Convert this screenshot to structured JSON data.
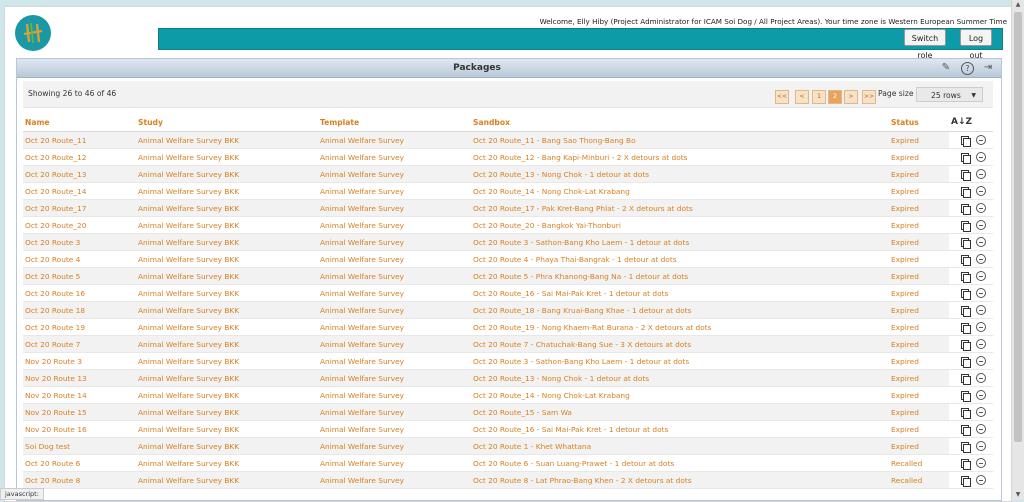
{
  "header": {
    "welcome": "Welcome, Elly Hiby (Project Administrator for ICAM Soi Dog / All Project Areas). Your time zone is Western European Summer Time",
    "switch_role": "Switch role",
    "logout": "Log out"
  },
  "panel": {
    "title": "Packages",
    "icons": [
      "pencil-icon",
      "help-icon",
      "exit-icon"
    ]
  },
  "toolbar": {
    "showing": "Showing 26 to 46 of 46",
    "pager": {
      "first": "<<",
      "prev": "<",
      "pages": [
        "1",
        "2"
      ],
      "next": ">",
      "last": ">>"
    },
    "page_size_label": "Page size",
    "page_size_value": "25 rows"
  },
  "table": {
    "columns": [
      "Name",
      "Study",
      "Template",
      "Sandbox",
      "Status"
    ],
    "rows": [
      [
        "Oct 20 Route_11",
        "Animal Welfare Survey BKK",
        "Animal Welfare Survey",
        "Oct 20 Route_11 - Bang Sao Thong-Bang Bo",
        "Expired"
      ],
      [
        "Oct 20 Route_12",
        "Animal Welfare Survey BKK",
        "Animal Welfare Survey",
        "Oct 20 Route_12 - Bang Kapi-Minburi - 2 X detours at dots",
        "Expired"
      ],
      [
        "Oct 20 Route_13",
        "Animal Welfare Survey BKK",
        "Animal Welfare Survey",
        "Oct 20 Route_13 - Nong Chok - 1 detour at dots",
        "Expired"
      ],
      [
        "Oct 20 Route_14",
        "Animal Welfare Survey BKK",
        "Animal Welfare Survey",
        "Oct 20 Route_14 - Nong Chok-Lat Krabang",
        "Expired"
      ],
      [
        "Oct 20 Route_17",
        "Animal Welfare Survey BKK",
        "Animal Welfare Survey",
        "Oct 20 Route_17 - Pak Kret-Bang Phlat - 2 X detours at dots",
        "Expired"
      ],
      [
        "Oct 20 Route_20",
        "Animal Welfare Survey BKK",
        "Animal Welfare Survey",
        "Oct 20 Route_20 - Bangkok Yai-Thonburi",
        "Expired"
      ],
      [
        "Oct 20 Route 3",
        "Animal Welfare Survey BKK",
        "Animal Welfare Survey",
        "Oct 20 Route 3 - Sathon-Bang Kho Laem - 1 detour at dots",
        "Expired"
      ],
      [
        "Oct 20 Route 4",
        "Animal Welfare Survey BKK",
        "Animal Welfare Survey",
        "Oct 20 Route 4 - Phaya Thai-Bangrak - 1 detour at dots",
        "Expired"
      ],
      [
        "Oct 20 Route 5",
        "Animal Welfare Survey BKK",
        "Animal Welfare Survey",
        "Oct 20 Route 5 - Phra Khanong-Bang Na - 1 detour at dots",
        "Expired"
      ],
      [
        "Oct 20 Route 16",
        "Animal Welfare Survey BKK",
        "Animal Welfare Survey",
        "Oct 20 Route_16 - Sai Mai-Pak Kret - 1 detour at dots",
        "Expired"
      ],
      [
        "Oct 20 Route 18",
        "Animal Welfare Survey BKK",
        "Animal Welfare Survey",
        "Oct 20 Route_18 - Bang Kruai-Bang Khae - 1 detour at dots",
        "Expired"
      ],
      [
        "Oct 20 Route 19",
        "Animal Welfare Survey BKK",
        "Animal Welfare Survey",
        "Oct 20 Route_19 - Nong Khaem-Rat Burana - 2 X detours at dots",
        "Expired"
      ],
      [
        "Oct 20 Route 7",
        "Animal Welfare Survey BKK",
        "Animal Welfare Survey",
        "Oct 20 Route 7 - Chatuchak-Bang Sue - 3 X detours at dots",
        "Expired"
      ],
      [
        "Nov 20 Route 3",
        "Animal Welfare Survey BKK",
        "Animal Welfare Survey",
        "Oct 20 Route 3 - Sathon-Bang Kho Laem - 1 detour at dots",
        "Expired"
      ],
      [
        "Nov 20 Route 13",
        "Animal Welfare Survey BKK",
        "Animal Welfare Survey",
        "Oct 20 Route_13 - Nong Chok - 1 detour at dots",
        "Expired"
      ],
      [
        "Nov 20 Route 14",
        "Animal Welfare Survey BKK",
        "Animal Welfare Survey",
        "Oct 20 Route_14 - Nong Chok-Lat Krabang",
        "Expired"
      ],
      [
        "Nov 20 Route 15",
        "Animal Welfare Survey BKK",
        "Animal Welfare Survey",
        "Oct 20 Route_15 - Sam Wa",
        "Expired"
      ],
      [
        "Nov 20 Route 16",
        "Animal Welfare Survey BKK",
        "Animal Welfare Survey",
        "Oct 20 Route_16 - Sai Mai-Pak Kret - 1 detour at dots",
        "Expired"
      ],
      [
        "Soi Dog test",
        "Animal Welfare Survey BKK",
        "Animal Welfare Survey",
        "Oct 20 Route 1 - Khet Whattana",
        "Expired"
      ],
      [
        "Oct 20 Route 6",
        "Animal Welfare Survey BKK",
        "Animal Welfare Survey",
        "Oct 20 Route 6 - Suan Luang-Prawet - 1 detour at dots",
        "Recalled"
      ],
      [
        "Oct 20 Route 8",
        "Animal Welfare Survey BKK",
        "Animal Welfare Survey",
        "Oct 20 Route 8 - Lat Phrao-Bang Khen - 2 X detours at dots",
        "Recalled"
      ]
    ]
  },
  "statusbar": "javascript:",
  "colors": {
    "accent_teal": "#0e9ba8",
    "link_orange": "#d97f20",
    "background": "#cfe7ea"
  }
}
